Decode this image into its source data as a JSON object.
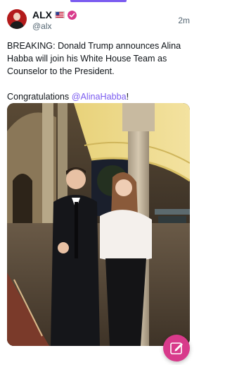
{
  "header": {
    "display_name": "ALX",
    "handle": "@alx",
    "timestamp": "2m"
  },
  "post": {
    "text_main": "BREAKING: Donald Trump announces Alina Habba will join his White House Team as Counselor to the President.",
    "text_congrats_prefix": "Congratulations ",
    "mention": "@AlinaHabba",
    "text_congrats_suffix": "!"
  },
  "icons": {
    "flag": "us-flag-icon",
    "verified": "verified-badge-icon",
    "compose": "compose-pencil-icon"
  },
  "colors": {
    "accent": "#7b5cf0",
    "brand_pink": "#d83a8b"
  }
}
